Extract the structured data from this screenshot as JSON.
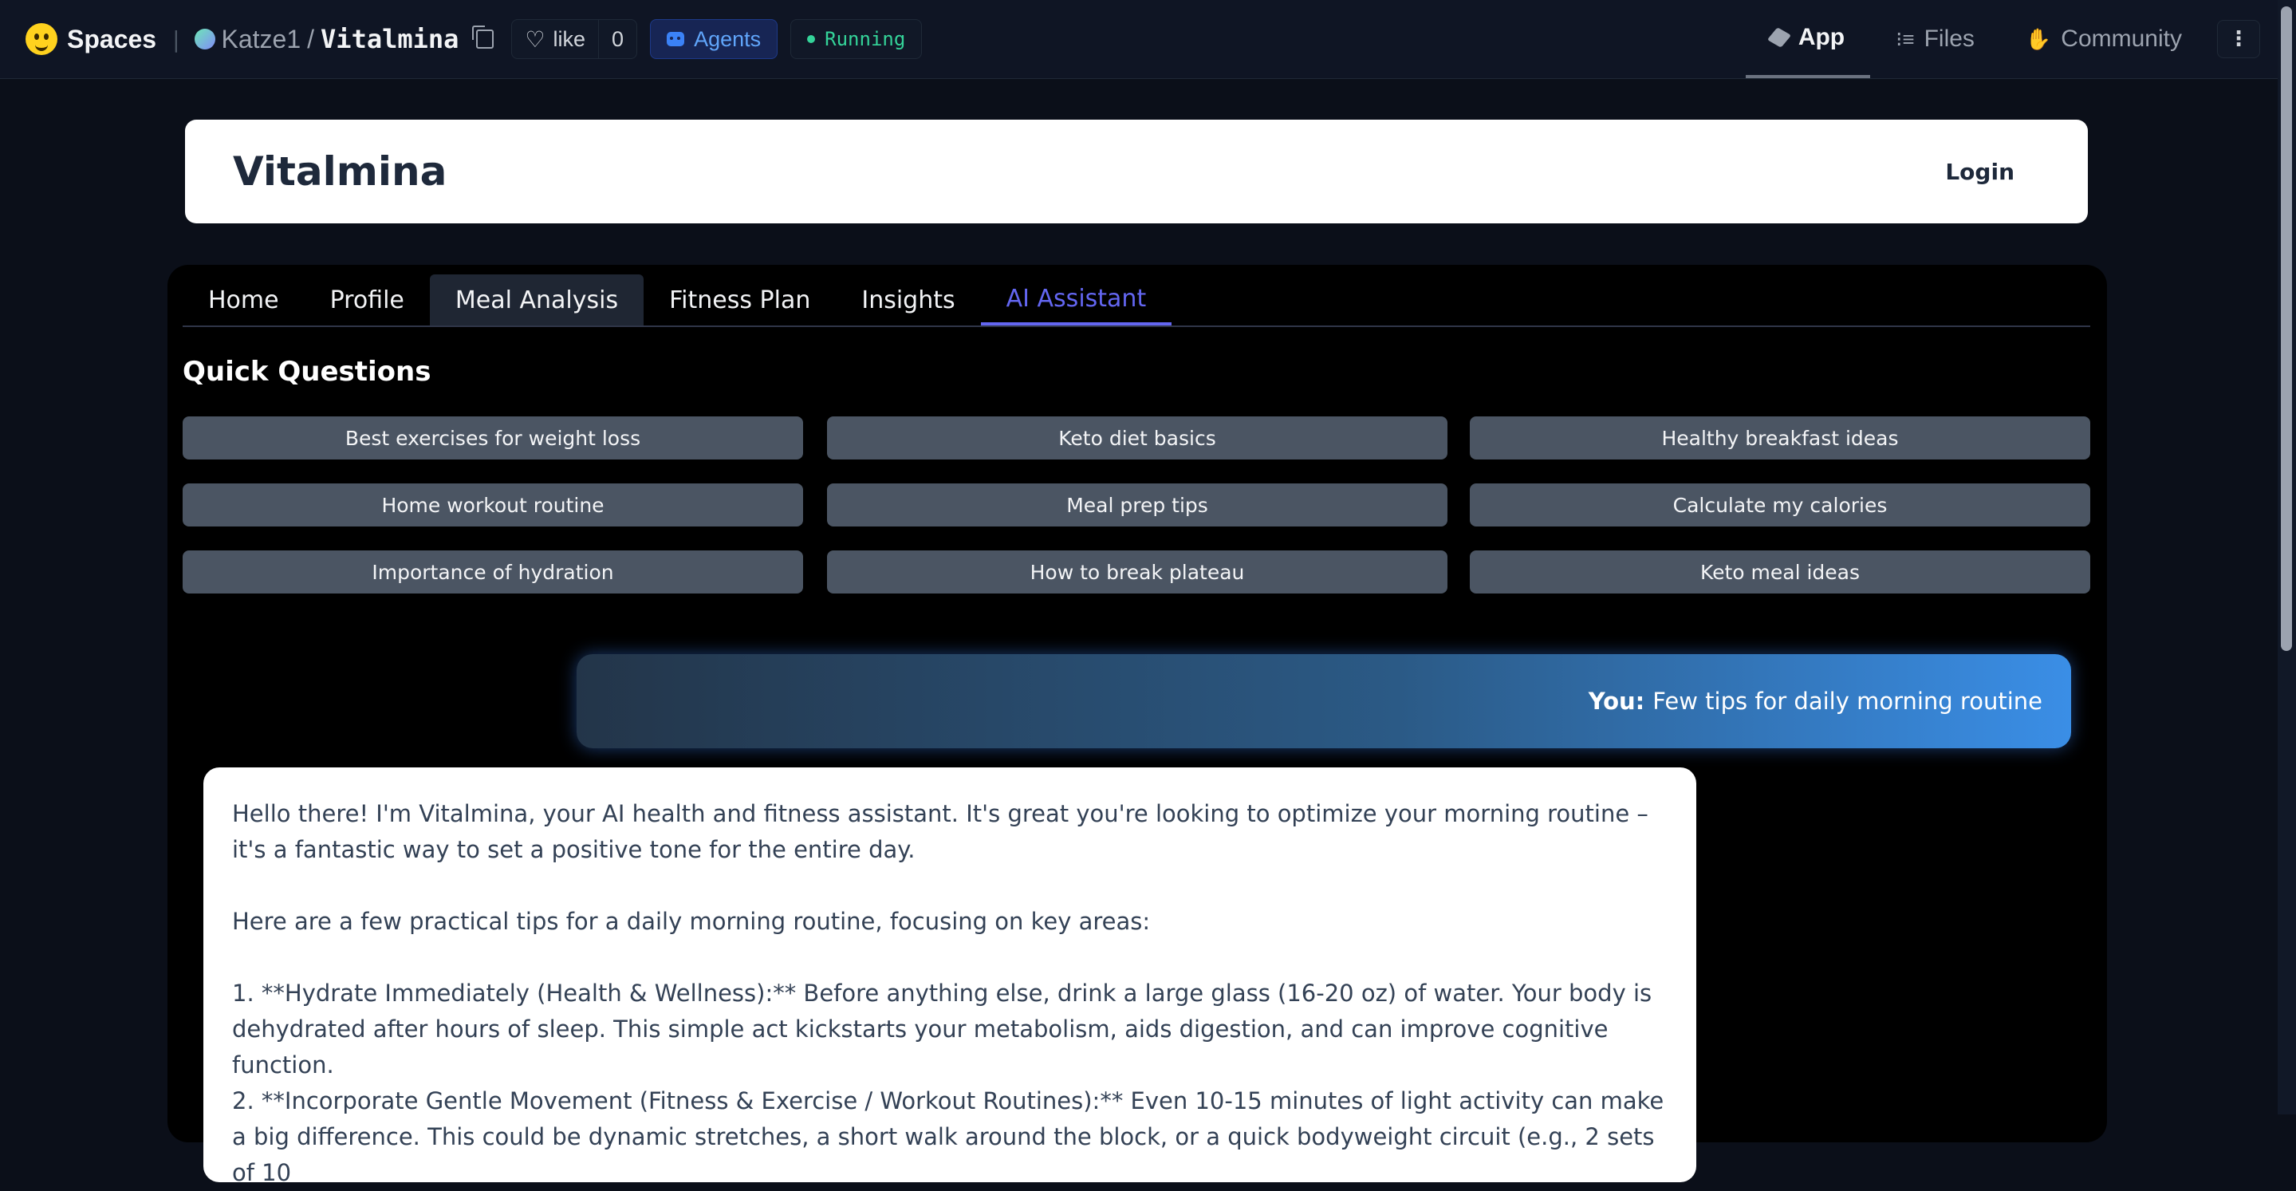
{
  "topbar": {
    "brand": "Spaces",
    "owner": "Katze1",
    "slash": "/",
    "repo": "Vitalmina",
    "like_label": "like",
    "like_count": "0",
    "agents_label": "Agents",
    "status": "Running",
    "nav": [
      {
        "label": "App",
        "icon": "app-cube-icon"
      },
      {
        "label": "Files",
        "icon": "files-icon"
      },
      {
        "label": "Community",
        "icon": "community-icon"
      }
    ],
    "menu_icon": "⋮"
  },
  "app": {
    "title": "Vitalmina",
    "login": "Login"
  },
  "tabs": [
    "Home",
    "Profile",
    "Meal Analysis",
    "Fitness Plan",
    "Insights",
    "AI Assistant"
  ],
  "active_tab": "AI Assistant",
  "quick_questions": {
    "title": "Quick Questions",
    "items": [
      "Best exercises for weight loss",
      "Keto diet basics",
      "Healthy breakfast ideas",
      "Home workout routine",
      "Meal prep tips",
      "Calculate my calories",
      "Importance of hydration",
      "How to break plateau",
      "Keto meal ideas"
    ]
  },
  "chat": {
    "user_prefix": "You:",
    "user_text": "Few tips for daily morning routine",
    "bot_paragraphs": [
      "Hello there! I'm Vitalmina, your AI health and fitness assistant. It's great you're looking to optimize your morning routine – it's a fantastic way to set a positive tone for the entire day.",
      "Here are a few practical tips for a daily morning routine, focusing on key areas:",
      "1. **Hydrate Immediately (Health & Wellness):** Before anything else, drink a large glass (16-20 oz) of water. Your body is dehydrated after hours of sleep. This simple act kickstarts your metabolism, aids digestion, and can improve cognitive function.",
      "2. **Incorporate Gentle Movement (Fitness & Exercise / Workout Routines):** Even 10-15 minutes of light activity can make a big difference. This could be dynamic stretches, a short walk around the block, or a quick bodyweight circuit (e.g., 2 sets of 10"
    ]
  },
  "colors": {
    "page_bg": "#0b0f19",
    "accent": "#6366f1",
    "quick_button": "#4b5563",
    "running": "#34d399"
  }
}
